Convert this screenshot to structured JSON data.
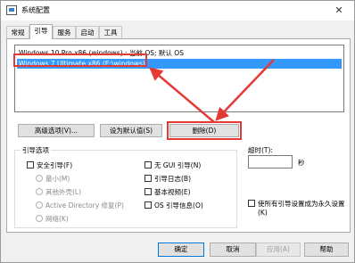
{
  "window": {
    "title": "系统配置",
    "close_symbol": "✕"
  },
  "tabs": [
    {
      "label": "常规"
    },
    {
      "label": "引导"
    },
    {
      "label": "服务"
    },
    {
      "label": "启动"
    },
    {
      "label": "工具"
    }
  ],
  "active_tab": "引导",
  "os_list": [
    {
      "label": "Windows 10 Pro x86 (windows) : 当前 OS; 默认 OS",
      "selected": false
    },
    {
      "label": "Windows 7 Ultimate x86 (E:\\windows)",
      "selected": true
    }
  ],
  "buttons": {
    "advanced": "高级选项(V)...",
    "set_default": "设为默认值(S)",
    "delete": "删除(D)"
  },
  "boot_options": {
    "group_label": "引导选项",
    "safe_boot": "安全引导(F)",
    "minimal": "最小(M)",
    "alternate_shell": "其他外壳(L)",
    "active_directory": "Active Directory 修复(P)",
    "network": "网络(K)",
    "no_gui": "无 GUI 引导(N)",
    "boot_log": "引导日志(B)",
    "base_video": "基本视频(E)",
    "os_boot_info": "OS 引导信息(O)"
  },
  "timeout": {
    "label": "超时(T):",
    "value": "",
    "unit": "秒"
  },
  "permanent": {
    "label": "使所有引导设置成为永久设置(K)"
  },
  "footer": {
    "ok": "确定",
    "cancel": "取消",
    "apply": "应用(A)",
    "help": "帮助"
  },
  "colors": {
    "selection": "#3399ff",
    "annotation": "#e53935",
    "default_button_border": "#0078d7"
  }
}
